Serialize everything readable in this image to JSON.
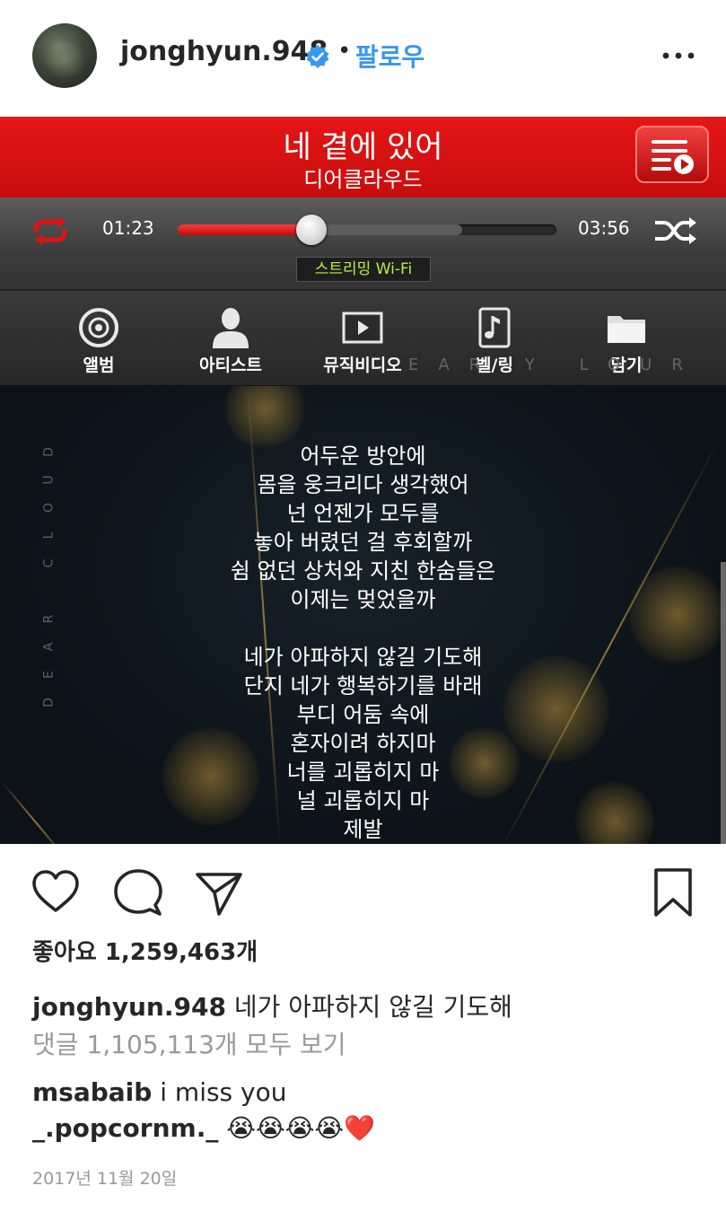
{
  "header": {
    "username": "jonghyun.948",
    "separator": "•",
    "follow_label": "팔로우",
    "icons": {
      "verified": "verified-badge-icon",
      "more": "more-options-icon"
    }
  },
  "player": {
    "song_title": "네 곁에 있어",
    "artist": "디어클라우드",
    "time_elapsed": "01:23",
    "time_total": "03:56",
    "progress_fraction": 0.352,
    "buffer_fraction": 0.75,
    "stream_badge": "스트리밍 Wi-Fi",
    "menu": [
      {
        "label": "앨범",
        "icon": "album-disc-icon"
      },
      {
        "label": "아티스트",
        "icon": "artist-person-icon"
      },
      {
        "label": "뮤직비디오",
        "icon": "music-video-icon"
      },
      {
        "label": "벨/링",
        "icon": "ringtone-note-icon"
      },
      {
        "label": "담기",
        "icon": "folder-icon"
      }
    ],
    "menu_watermark": "EAR Y LOUR",
    "side_watermark": "DEAR CLOUD",
    "lyrics": [
      "어두운 방안에",
      "몸을 웅크리다 생각했어",
      "넌 언젠가 모두를",
      "놓아 버렸던 걸 후회할까",
      "쉼 없던 상처와 지친 한숨들은",
      "이제는 멎었을까",
      "",
      "네가 아파하지 않길 기도해",
      "단지 네가 행복하기를 바래",
      "부디 어둠 속에",
      "혼자이려 하지마",
      "너를 괴롭히지 마",
      "널 괴롭히지 마",
      "제발"
    ],
    "colors": {
      "header_red": "#e51616",
      "stream_green": "#b7f23a",
      "progress_red": "#ff3b3b"
    }
  },
  "post": {
    "likes_text": "좋아요 1,259,463개",
    "caption_user": "jonghyun.948",
    "caption_text": "네가 아파하지 않길 기도해",
    "view_comments": "댓글 1,105,113개 모두 보기",
    "comments": [
      {
        "user": "msabaib",
        "text": "i miss you"
      },
      {
        "user": "_.popcornm._",
        "text": "😭😭😭😭❤️"
      }
    ],
    "date": "2017년 11월 20일",
    "icons": {
      "like": "heart-icon",
      "comment": "comment-bubble-icon",
      "share": "send-paper-plane-icon",
      "save": "bookmark-icon"
    }
  }
}
